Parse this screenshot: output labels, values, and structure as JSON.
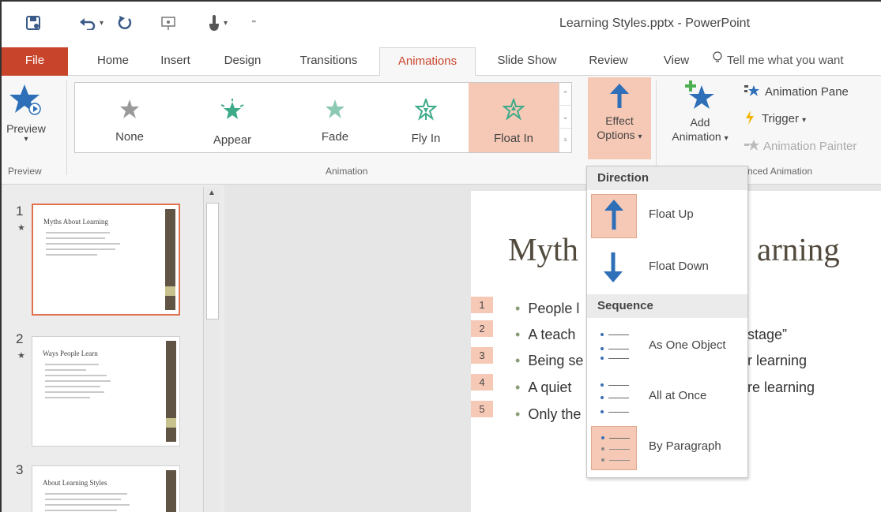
{
  "window": {
    "title": "Learning Styles.pptx - PowerPoint"
  },
  "qat": {
    "items": [
      {
        "name": "save-icon",
        "glyph": "🖫"
      },
      {
        "name": "undo-icon",
        "glyph": "↶"
      },
      {
        "name": "redo-icon",
        "glyph": "↻"
      },
      {
        "name": "slideshow-icon",
        "glyph": "⎚"
      },
      {
        "name": "touch-mode-icon",
        "glyph": "☝"
      },
      {
        "name": "customize-qat-icon",
        "glyph": "⁼"
      }
    ],
    "dropdown_glyph": "▾"
  },
  "tabs": [
    "File",
    "Home",
    "Insert",
    "Design",
    "Transitions",
    "Animations",
    "Slide Show",
    "Review",
    "View"
  ],
  "active_tab": "Animations",
  "tell_me": {
    "icon": "lightbulb-icon",
    "text": "Tell me what you want"
  },
  "ribbon": {
    "preview": {
      "label": "Preview",
      "dropdown": "▾",
      "group": "Preview"
    },
    "animation_group": "Animation",
    "gallery": [
      {
        "label": "None",
        "color": "#9a9a9a"
      },
      {
        "label": "Appear",
        "color": "#3daa8a"
      },
      {
        "label": "Fade",
        "color": "#6fb89c"
      },
      {
        "label": "Fly In",
        "color": "#3daa8a"
      },
      {
        "label": "Float In",
        "color": "#3daa8a",
        "selected": true
      }
    ],
    "effect_options": {
      "line1": "Effect",
      "line2": "Options",
      "dropdown": "▾"
    },
    "add_animation": {
      "line1": "Add",
      "line2": "Animation",
      "dropdown": "▾"
    },
    "advanced": {
      "animation_pane": "Animation Pane",
      "trigger": "Trigger",
      "trigger_dropdown": "▾",
      "animation_painter": "Animation Painter",
      "group": "nced Animation"
    }
  },
  "thumbnails": [
    {
      "number": "1",
      "title": "Myths About Learning",
      "selected": true,
      "lines": 5
    },
    {
      "number": "2",
      "title": "Ways People Learn",
      "selected": false,
      "lines": 7
    },
    {
      "number": "3",
      "title": "About Learning Styles",
      "selected": false,
      "lines": 4
    }
  ],
  "slide": {
    "title_left": "Myth",
    "title_right": "arning",
    "bullets": [
      {
        "tag": "1",
        "left": "People l",
        "right": ""
      },
      {
        "tag": "2",
        "left": "A teach",
        "right": "stage”"
      },
      {
        "tag": "3",
        "left": "Being se",
        "right": "r learning"
      },
      {
        "tag": "4",
        "left": "A quiet",
        "right": "re learning"
      },
      {
        "tag": "5",
        "left": "Only the",
        "right": ""
      }
    ]
  },
  "menu": {
    "direction_header": "Direction",
    "sequence_header": "Sequence",
    "direction_items": [
      {
        "label": "Float Up",
        "selected": true
      },
      {
        "label": "Float Down",
        "selected": false
      }
    ],
    "sequence_items": [
      {
        "label": "As One Object",
        "selected": false
      },
      {
        "label": "All at Once",
        "selected": false
      },
      {
        "label": "By Paragraph",
        "selected": true
      }
    ]
  },
  "colors": {
    "file_tab": "#c8452c",
    "active_tab_text": "#c8452c",
    "selection_fill": "#f6c9b6",
    "arrow_blue": "#2e6fb8",
    "star_blue": "#2e6fb8"
  }
}
